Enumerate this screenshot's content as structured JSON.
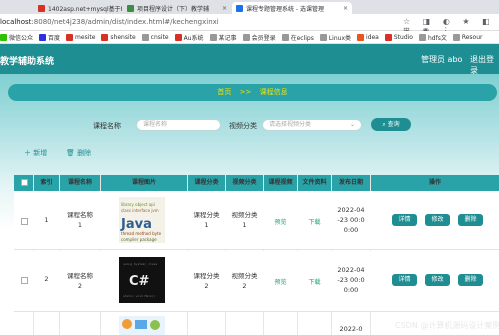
{
  "browser": {
    "tabs": [
      {
        "title": "1402asp.net+mysql基于M",
        "color": "#d93025"
      },
      {
        "title": "项目程序设计（下）教学辅",
        "color": "#3c8e44"
      },
      {
        "title": "课程专题管理系统 - 选课管理",
        "color": "#1a73e8"
      }
    ],
    "url_host": "localhost",
    "url_path": ":8080/net4j238/admin/dist/index.html#/kechengxinxi",
    "bookmarks": [
      {
        "label": "微信公众",
        "color": "#2dc100"
      },
      {
        "label": "百度",
        "color": "#2932e1"
      },
      {
        "label": "mesite",
        "color": "#d93025"
      },
      {
        "label": "shensite",
        "color": "#d93025"
      },
      {
        "label": "cnsite",
        "color": "#999999"
      },
      {
        "label": "Au系统",
        "color": "#d93025"
      },
      {
        "label": "某记事",
        "color": "#999999"
      },
      {
        "label": "会员登录",
        "color": "#999999"
      },
      {
        "label": "在eclips",
        "color": "#999999"
      },
      {
        "label": "Linux类",
        "color": "#999999"
      },
      {
        "label": "idea",
        "color": "#e95420"
      },
      {
        "label": "Studio",
        "color": "#d93025"
      },
      {
        "label": "hdfs文",
        "color": "#999999"
      },
      {
        "label": "Resour",
        "color": "#999999"
      }
    ]
  },
  "header": {
    "title": "教学辅助系统",
    "admin": "管理员 abo",
    "logout": "退出登录"
  },
  "breadcrumb": {
    "home": "首页",
    "sep": ">>",
    "current": "课程信息"
  },
  "search": {
    "course_label": "课程名称",
    "course_placeholder": "课程名称",
    "video_label": "视频分类",
    "video_placeholder": "请选择视频分类",
    "query": "查询"
  },
  "toolbar": {
    "add": "新增",
    "delete": "删除"
  },
  "table": {
    "headers": [
      "索引",
      "课程名称",
      "课程图片",
      "课程分类",
      "视频分类",
      "课程视频",
      "文件资料",
      "发布日期",
      "操作"
    ],
    "rows": [
      {
        "index": "1",
        "name_a": "课程名称",
        "name_b": "1",
        "cat_a": "课程分类",
        "cat_b": "1",
        "vid_a": "视频分类",
        "vid_b": "1",
        "video": "预览",
        "file": "下载",
        "d1": "2022-04",
        "d2": "-23 00:0",
        "d3": "0:00"
      },
      {
        "index": "2",
        "name_a": "课程名称",
        "name_b": "2",
        "cat_a": "课程分类",
        "cat_b": "2",
        "vid_a": "视频分类",
        "vid_b": "2",
        "video": "预览",
        "file": "下载",
        "d1": "2022-04",
        "d2": "-23 00:0",
        "d3": "0:00"
      },
      {
        "d1": "2022-0"
      }
    ],
    "actions": {
      "detail": "详情",
      "edit": "修改",
      "del": "删除"
    }
  },
  "watermark": "CSDN @计算机源码设计案例"
}
